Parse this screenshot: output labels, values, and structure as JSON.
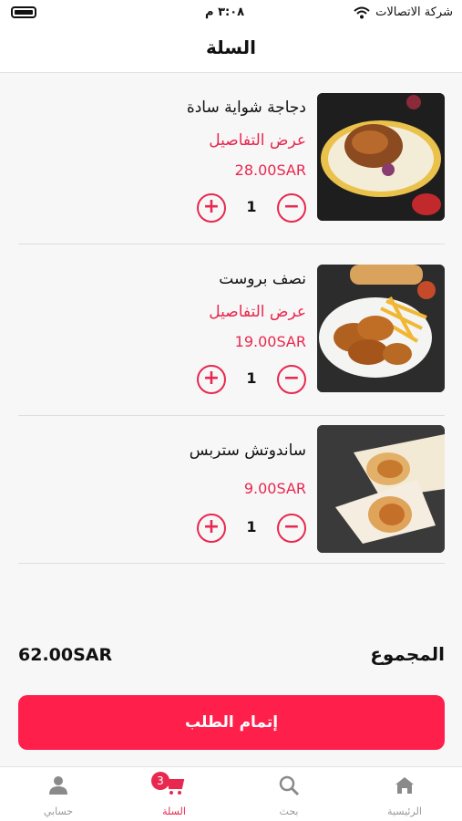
{
  "status_bar": {
    "carrier": "شركة الاتصالات",
    "time": "٣:٠٨ م"
  },
  "header": {
    "title": "السلة"
  },
  "cart": {
    "details_label": "عرض التفاصيل",
    "items": [
      {
        "name": "دجاجة شواية سادة",
        "show_details": true,
        "price": "28.00SAR",
        "quantity": "1",
        "image_icon": "roast-chicken-plate"
      },
      {
        "name": "نصف بروست",
        "show_details": true,
        "price": "19.00SAR",
        "quantity": "1",
        "image_icon": "fried-chicken-fries"
      },
      {
        "name": "ساندوتش ستربس",
        "show_details": false,
        "price": "9.00SAR",
        "quantity": "1",
        "image_icon": "wrap-sandwich"
      }
    ],
    "plus_symbol": "+",
    "minus_symbol": "−"
  },
  "summary": {
    "total_label": "المجموع",
    "total_value": "62.00SAR"
  },
  "checkout": {
    "label": "إتمام الطلب"
  },
  "tabbar": {
    "tabs": [
      {
        "label": "الرئيسية",
        "icon": "home-icon"
      },
      {
        "label": "بحث",
        "icon": "search-icon"
      },
      {
        "label": "السلة",
        "icon": "cart-icon",
        "badge": "3",
        "active": true
      },
      {
        "label": "حسابي",
        "icon": "user-icon"
      }
    ]
  },
  "colors": {
    "accent": "#e8284f",
    "button": "#ff1f4b"
  }
}
